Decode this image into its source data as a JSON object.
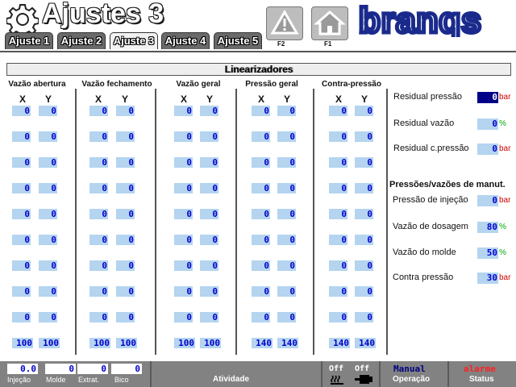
{
  "header": {
    "title": "Ajustes 3",
    "tabs": [
      "Ajuste 1",
      "Ajuste 2",
      "Ajuste 3",
      "Ajuste 4",
      "Ajuste 5"
    ],
    "active_tab": "Ajuste 3",
    "f2_label": "F2",
    "f1_label": "F1",
    "logo": "branqs"
  },
  "section": {
    "title": "Linearizadores"
  },
  "columns": [
    {
      "title": "Vazão abertura",
      "x_label": "X",
      "y_label": "Y"
    },
    {
      "title": "Vazão fechamento",
      "x_label": "X",
      "y_label": "Y"
    },
    {
      "title": "Vazão geral",
      "x_label": "X",
      "y_label": "Y"
    },
    {
      "title": "Pressão geral",
      "x_label": "X",
      "y_label": "Y"
    },
    {
      "title": "Contra-pressão",
      "x_label": "X",
      "y_label": "Y"
    }
  ],
  "table_values": [
    [
      [
        "0",
        "0"
      ],
      [
        "0",
        "0"
      ],
      [
        "0",
        "0"
      ],
      [
        "0",
        "0"
      ],
      [
        "0",
        "0"
      ],
      [
        "0",
        "0"
      ],
      [
        "0",
        "0"
      ],
      [
        "0",
        "0"
      ],
      [
        "0",
        "0"
      ],
      [
        "100",
        "100"
      ]
    ],
    [
      [
        "0",
        "0"
      ],
      [
        "0",
        "0"
      ],
      [
        "0",
        "0"
      ],
      [
        "0",
        "0"
      ],
      [
        "0",
        "0"
      ],
      [
        "0",
        "0"
      ],
      [
        "0",
        "0"
      ],
      [
        "0",
        "0"
      ],
      [
        "0",
        "0"
      ],
      [
        "100",
        "100"
      ]
    ],
    [
      [
        "0",
        "0"
      ],
      [
        "0",
        "0"
      ],
      [
        "0",
        "0"
      ],
      [
        "0",
        "0"
      ],
      [
        "0",
        "0"
      ],
      [
        "0",
        "0"
      ],
      [
        "0",
        "0"
      ],
      [
        "0",
        "0"
      ],
      [
        "0",
        "0"
      ],
      [
        "100",
        "100"
      ]
    ],
    [
      [
        "0",
        "0"
      ],
      [
        "0",
        "0"
      ],
      [
        "0",
        "0"
      ],
      [
        "0",
        "0"
      ],
      [
        "0",
        "0"
      ],
      [
        "0",
        "0"
      ],
      [
        "0",
        "0"
      ],
      [
        "0",
        "0"
      ],
      [
        "0",
        "0"
      ],
      [
        "140",
        "140"
      ]
    ],
    [
      [
        "0",
        "0"
      ],
      [
        "0",
        "0"
      ],
      [
        "0",
        "0"
      ],
      [
        "0",
        "0"
      ],
      [
        "0",
        "0"
      ],
      [
        "0",
        "0"
      ],
      [
        "0",
        "0"
      ],
      [
        "0",
        "0"
      ],
      [
        "0",
        "0"
      ],
      [
        "140",
        "140"
      ]
    ]
  ],
  "right_panel": {
    "residuals": [
      {
        "label": "Residual pressão",
        "value": "0",
        "unit": "bar",
        "unit_color": "#cc0000",
        "selected": true
      },
      {
        "label": "Residual vazão",
        "value": "0",
        "unit": "%",
        "unit_color": "#00aa00",
        "selected": false
      },
      {
        "label": "Residual c.pressão",
        "value": "0",
        "unit": "bar",
        "unit_color": "#cc0000",
        "selected": false
      }
    ],
    "subtitle": "Pressões/vazões de manut.",
    "maintenance": [
      {
        "label": "Pressão de injeção",
        "value": "0",
        "unit": "bar",
        "unit_color": "#cc0000"
      },
      {
        "label": "Vazão de dosagem",
        "value": "80",
        "unit": "%",
        "unit_color": "#00aa00"
      },
      {
        "label": "Vazão do molde",
        "value": "50",
        "unit": "%",
        "unit_color": "#00aa00"
      },
      {
        "label": "Contra pressão",
        "value": "30",
        "unit": "bar",
        "unit_color": "#cc0000"
      }
    ]
  },
  "footer": {
    "counters": [
      {
        "label": "Injeção",
        "value": "0.0"
      },
      {
        "label": "Molde",
        "value": "0"
      },
      {
        "label": "Extrat.",
        "value": "0"
      },
      {
        "label": "Bico",
        "value": "0"
      }
    ],
    "activity_label": "Atividade",
    "off1": "Off",
    "off2": "Off",
    "mode_value": "Manual",
    "mode_label": "Operação",
    "status_value": "alarme",
    "status_label": "Status"
  },
  "colors": {
    "value_bg": "#b4d4f0",
    "value_text": "#0000cc",
    "logo": "#1a2a8c",
    "footer_bg": "#828282",
    "alarm": "#ff2020"
  }
}
